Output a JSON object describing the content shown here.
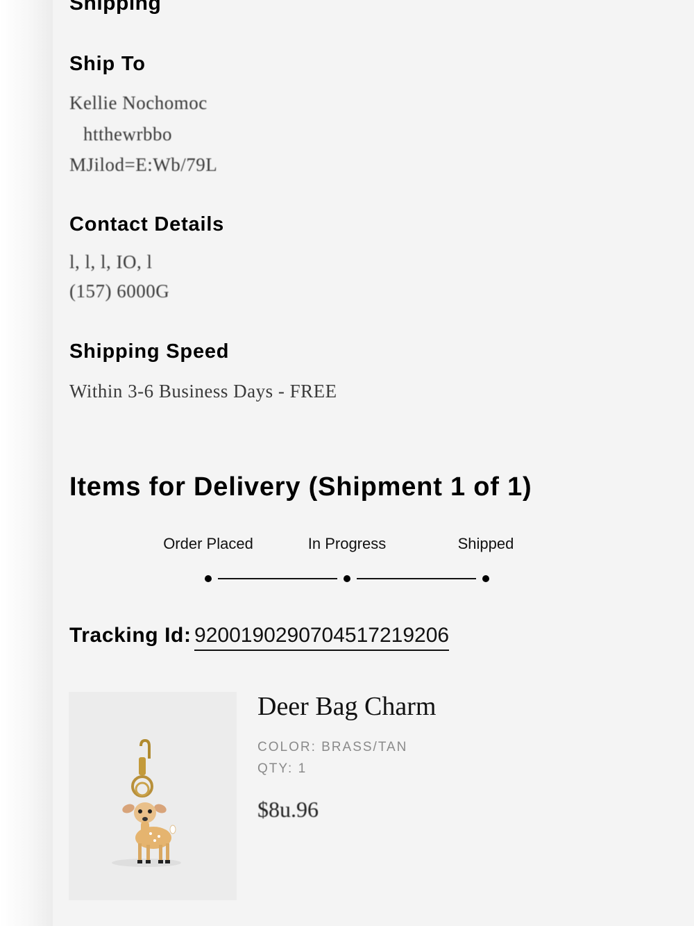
{
  "shipping": {
    "section_title": "Shipping",
    "ship_to": {
      "heading": "Ship To",
      "lines": [
        "Kellie Nochomoc",
        "htthewrbbo",
        "MJilod=E:Wb/79L"
      ]
    },
    "contact": {
      "heading": "Contact Details",
      "lines": [
        "l, l, l, IO, l",
        "(157) 6000G"
      ]
    },
    "speed": {
      "heading": "Shipping Speed",
      "value": "Within 3-6 Business Days - FREE"
    }
  },
  "delivery": {
    "title": "Items for Delivery (Shipment 1 of 1)",
    "steps": [
      "Order Placed",
      "In Progress",
      "Shipped"
    ],
    "tracking_label": "Tracking Id:",
    "tracking_id": "9200190290704517219206"
  },
  "item": {
    "name": "Deer Bag Charm",
    "color": "COLOR: BRASS/TAN",
    "qty": "QTY: 1",
    "price": "$8u.96"
  }
}
